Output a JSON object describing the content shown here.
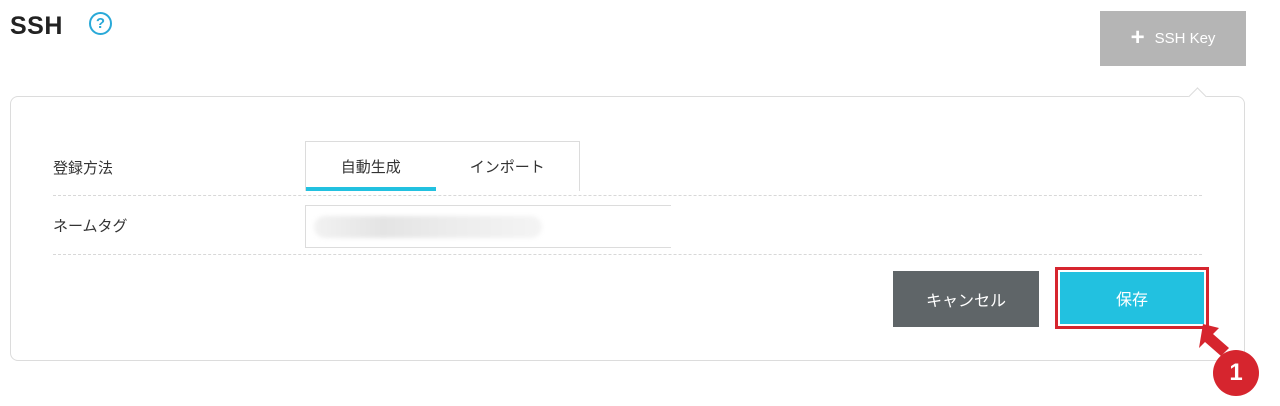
{
  "header": {
    "title": "SSH",
    "help_icon": "?"
  },
  "toolbar": {
    "add_key_label": "SSH Key",
    "add_key_icon": "plus-icon"
  },
  "form": {
    "method_label": "登録方法",
    "tabs": [
      {
        "label": "自動生成",
        "active": true
      },
      {
        "label": "インポート",
        "active": false
      }
    ],
    "name_tag_label": "ネームタグ",
    "name_tag_value": ""
  },
  "actions": {
    "cancel_label": "キャンセル",
    "save_label": "保存"
  },
  "annotation": {
    "step_number": "1"
  },
  "colors": {
    "accent": "#22c1e0",
    "cancel": "#5f6568",
    "disabled": "#b5b5b5",
    "highlight": "#d6252e"
  }
}
